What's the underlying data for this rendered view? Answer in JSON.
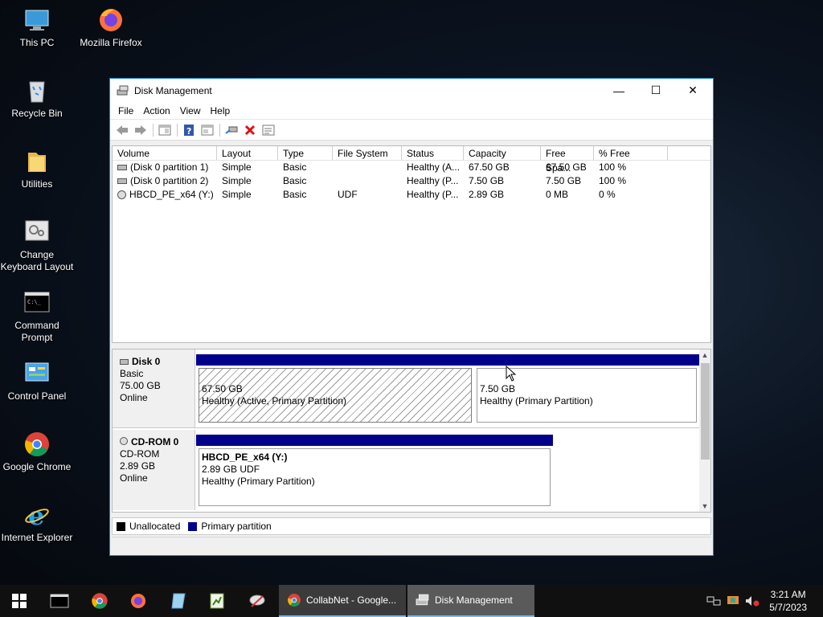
{
  "desktop": {
    "icons": [
      {
        "label_lines": [
          "This PC"
        ]
      },
      {
        "label_lines": [
          "Mozilla Firefox"
        ]
      },
      {
        "label_lines": [
          "Recycle Bin"
        ]
      },
      {
        "label_lines": [
          "Utilities"
        ]
      },
      {
        "label_lines": [
          "Change",
          "Keyboard Layout"
        ]
      },
      {
        "label_lines": [
          "Command",
          "Prompt"
        ]
      },
      {
        "label_lines": [
          "Control Panel"
        ]
      },
      {
        "label_lines": [
          "Google Chrome"
        ]
      },
      {
        "label_lines": [
          "Internet Explorer"
        ]
      }
    ]
  },
  "window": {
    "title": "Disk Management",
    "controls": {
      "minimize": "—",
      "maximize": "☐",
      "close": "✕"
    },
    "menu": [
      "File",
      "Action",
      "View",
      "Help"
    ],
    "toolbar_icons": [
      "back-arrow-icon",
      "forward-arrow-icon",
      "console-tree-icon",
      "help-icon",
      "properties-icon",
      "connect-icon",
      "delete-icon",
      "checklist-icon"
    ]
  },
  "volumes": {
    "columns": [
      "Volume",
      "Layout",
      "Type",
      "File System",
      "Status",
      "Capacity",
      "Free Spa...",
      "% Free"
    ],
    "rows": [
      {
        "volume": "(Disk 0 partition 1)",
        "layout": "Simple",
        "type": "Basic",
        "fs": "",
        "status": "Healthy (A...",
        "capacity": "67.50 GB",
        "free": "67.50 GB",
        "pct": "100 %"
      },
      {
        "volume": "(Disk 0 partition 2)",
        "layout": "Simple",
        "type": "Basic",
        "fs": "",
        "status": "Healthy (P...",
        "capacity": "7.50 GB",
        "free": "7.50 GB",
        "pct": "100 %"
      },
      {
        "volume": "HBCD_PE_x64 (Y:)",
        "layout": "Simple",
        "type": "Basic",
        "fs": "UDF",
        "status": "Healthy (P...",
        "capacity": "2.89 GB",
        "free": "0 MB",
        "pct": "0 %"
      }
    ]
  },
  "disks": {
    "disk0": {
      "name": "Disk 0",
      "type": "Basic",
      "size": "75.00 GB",
      "state": "Online",
      "p1": {
        "size": "67.50 GB",
        "status": "Healthy (Active, Primary Partition)"
      },
      "p2": {
        "size": "7.50 GB",
        "status": "Healthy (Primary Partition)"
      }
    },
    "cdrom0": {
      "name": "CD-ROM 0",
      "type": "CD-ROM",
      "size": "2.89 GB",
      "state": "Online",
      "p1": {
        "label": "HBCD_PE_x64  (Y:)",
        "size": "2.89 GB UDF",
        "status": "Healthy (Primary Partition)"
      }
    }
  },
  "legend": {
    "unallocated": "Unallocated",
    "primary": "Primary partition"
  },
  "colors": {
    "primary_partition": "#01008b",
    "unallocated": "#000000",
    "title_accent": "#1883d7"
  },
  "taskbar": {
    "windows_tab": "CollabNet - Google...",
    "active_tab": "Disk Management",
    "time": "3:21 AM",
    "date": "5/7/2023"
  }
}
